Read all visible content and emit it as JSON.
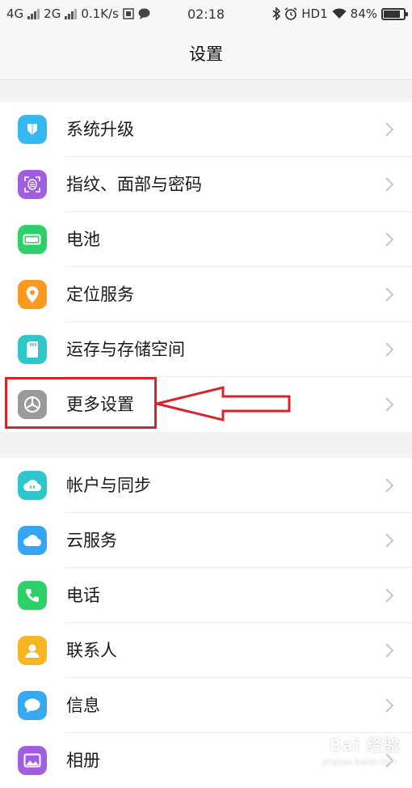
{
  "status_bar": {
    "network1": "4G",
    "network2": "2G",
    "speed": "0.1K/s",
    "time": "02:18",
    "hd": "HD1",
    "battery": "84%",
    "battery_level": 0.84
  },
  "header": {
    "title": "设置"
  },
  "groups": [
    {
      "items": [
        {
          "label": "系统升级",
          "icon": "system-update-icon",
          "color": "#35b8f0"
        },
        {
          "label": "指纹、面部与密码",
          "icon": "fingerprint-icon",
          "color": "#a05ee0"
        },
        {
          "label": "电池",
          "icon": "battery-icon",
          "color": "#2fcf6a"
        },
        {
          "label": "定位服务",
          "icon": "location-pin-icon",
          "color": "#fb9a1e"
        },
        {
          "label": "运存与存储空间",
          "icon": "sd-card-icon",
          "color": "#2ec6c9"
        },
        {
          "label": "更多设置",
          "icon": "gear-icon",
          "color": "#9a9a9a"
        }
      ]
    },
    {
      "items": [
        {
          "label": "帐户与同步",
          "icon": "account-sync-icon",
          "color": "#2ec6c9"
        },
        {
          "label": "云服务",
          "icon": "cloud-icon",
          "color": "#36a6f2"
        },
        {
          "label": "电话",
          "icon": "phone-icon",
          "color": "#2fcf6a"
        },
        {
          "label": "联系人",
          "icon": "contact-icon",
          "color": "#f8b522"
        },
        {
          "label": "信息",
          "icon": "message-icon",
          "color": "#38a9ee"
        },
        {
          "label": "相册",
          "icon": "album-icon",
          "color": "#a05ee0"
        }
      ]
    }
  ],
  "annotation": {
    "highlight_color": "#d8232a"
  },
  "watermark": {
    "brand": "Bai 经验",
    "url": "jingyan.baidu.com"
  }
}
